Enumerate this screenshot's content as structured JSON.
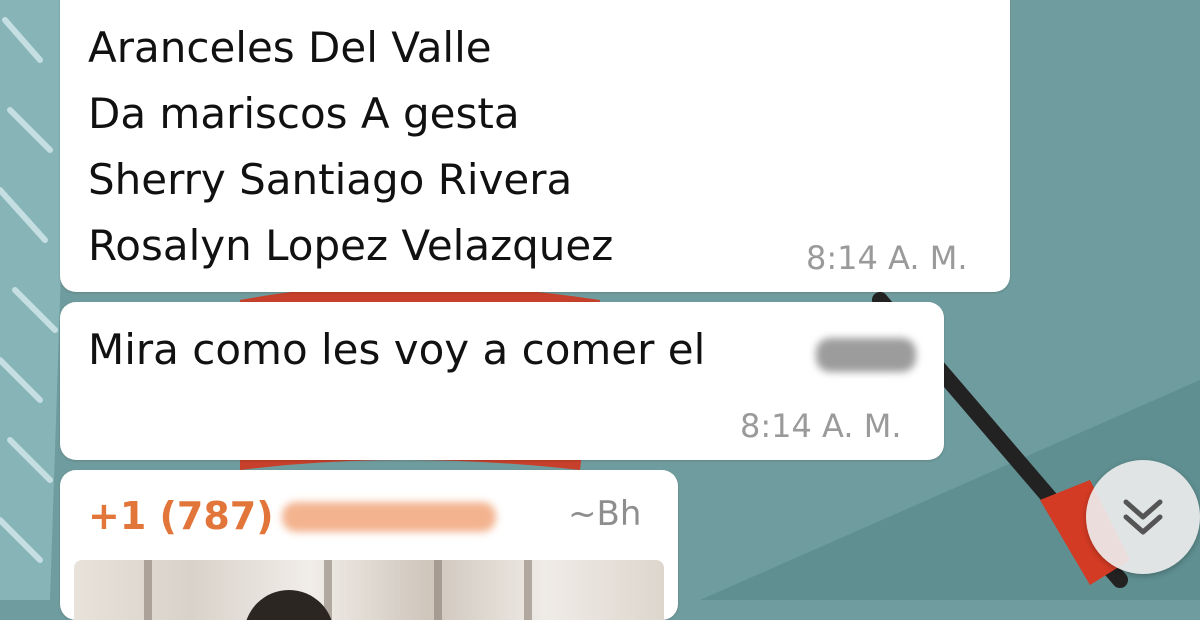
{
  "messages": [
    {
      "lines": [
        "Aranceles Del Valle",
        "Da mariscos A gesta",
        "Sherry Santiago Rivera",
        "Rosalyn Lopez Velazquez"
      ],
      "time": "8:14 A. M."
    },
    {
      "text": "Mira como les voy a comer el",
      "time": "8:14 A. M."
    },
    {
      "sender": "+1 (787)",
      "alias": "~Bh"
    }
  ],
  "icons": {
    "scroll_down": "double-chevron-down-icon"
  },
  "colors": {
    "wallpaper": "#6f9c9e",
    "bubble": "#ffffff",
    "sender_name": "#e2763a",
    "timestamp": "#9a9a9a"
  }
}
